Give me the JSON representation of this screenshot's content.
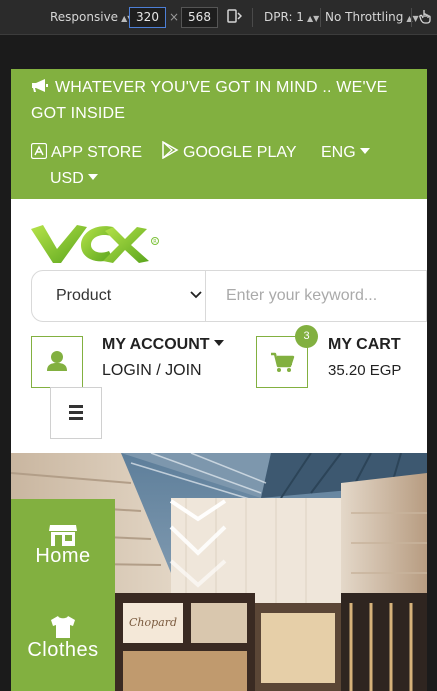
{
  "devtools": {
    "device": "Responsive",
    "width": "320",
    "times": "×",
    "height": "568",
    "dpr": "DPR: 1",
    "throttling": "No Throttling"
  },
  "topbar": {
    "promo": "WHATEVER YOU'VE GOT IN MIND .. WE'VE GOT INSIDE",
    "app_store": "APP STORE",
    "google_play": "GOOGLE PLAY",
    "language": "ENG",
    "currency": "USD"
  },
  "search": {
    "category": "Product",
    "placeholder": "Enter your keyword..."
  },
  "account": {
    "title": "MY ACCOUNT",
    "subtitle": "LOGIN / JOIN"
  },
  "cart": {
    "title": "MY CART",
    "total": "35.20 EGP",
    "count": "3"
  },
  "categories": [
    {
      "label": "Home",
      "icon": "store-icon"
    },
    {
      "label": "Clothes",
      "icon": "tshirt-icon"
    }
  ],
  "colors": {
    "brand_green": "#82b040",
    "devtools_bg": "#2b2b2b"
  }
}
